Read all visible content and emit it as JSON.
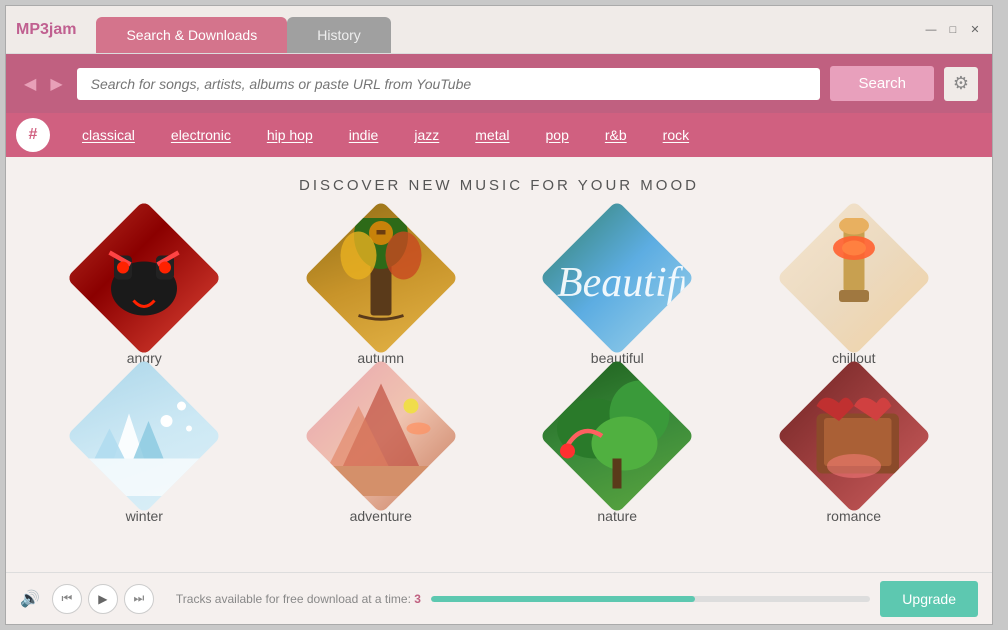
{
  "app": {
    "logo": "MP3jam",
    "window_controls": {
      "minimize": "—",
      "maximize": "□",
      "close": "✕"
    }
  },
  "tabs": [
    {
      "id": "search",
      "label": "Search & Downloads",
      "active": true
    },
    {
      "id": "history",
      "label": "History",
      "active": false
    }
  ],
  "search": {
    "placeholder": "Search for songs, artists, albums or paste URL from YouTube",
    "button_label": "Search",
    "value": ""
  },
  "genres": {
    "hash_label": "#",
    "items": [
      {
        "id": "classical",
        "label": "classical"
      },
      {
        "id": "electronic",
        "label": "electronic"
      },
      {
        "id": "hiphop",
        "label": "hip hop"
      },
      {
        "id": "indie",
        "label": "indie"
      },
      {
        "id": "jazz",
        "label": "jazz"
      },
      {
        "id": "metal",
        "label": "metal"
      },
      {
        "id": "pop",
        "label": "pop"
      },
      {
        "id": "rnb",
        "label": "r&b"
      },
      {
        "id": "rock",
        "label": "rock"
      }
    ]
  },
  "discover": {
    "title": "DISCOVER NEW MUSIC FOR YOUR MOOD",
    "moods": [
      {
        "id": "angry",
        "label": "angry",
        "css_class": "mood-angry"
      },
      {
        "id": "autumn",
        "label": "autumn",
        "css_class": "mood-autumn"
      },
      {
        "id": "beautiful",
        "label": "beautiful",
        "css_class": "mood-beautiful"
      },
      {
        "id": "chillout",
        "label": "chillout",
        "css_class": "mood-chillout"
      },
      {
        "id": "winter",
        "label": "winter",
        "css_class": "mood-winter"
      },
      {
        "id": "adventure",
        "label": "adventure",
        "css_class": "mood-adventure"
      },
      {
        "id": "nature",
        "label": "nature",
        "css_class": "mood-nature"
      },
      {
        "id": "romance",
        "label": "romance",
        "css_class": "mood-romance"
      }
    ]
  },
  "player": {
    "volume_icon": "🔊",
    "prev_icon": "⏮",
    "play_icon": "▶",
    "next_icon": "⏭"
  },
  "upgrade_bar": {
    "text": "Tracks available for free download at a time:",
    "count": "3",
    "progress_percent": 60,
    "button_label": "Upgrade"
  },
  "colors": {
    "brand_pink": "#c06080",
    "tab_active": "#d4748c",
    "tab_inactive": "#a0a0a0",
    "genre_bg": "#d06080",
    "search_bg": "#c06080",
    "progress_green": "#5dc8b0"
  }
}
